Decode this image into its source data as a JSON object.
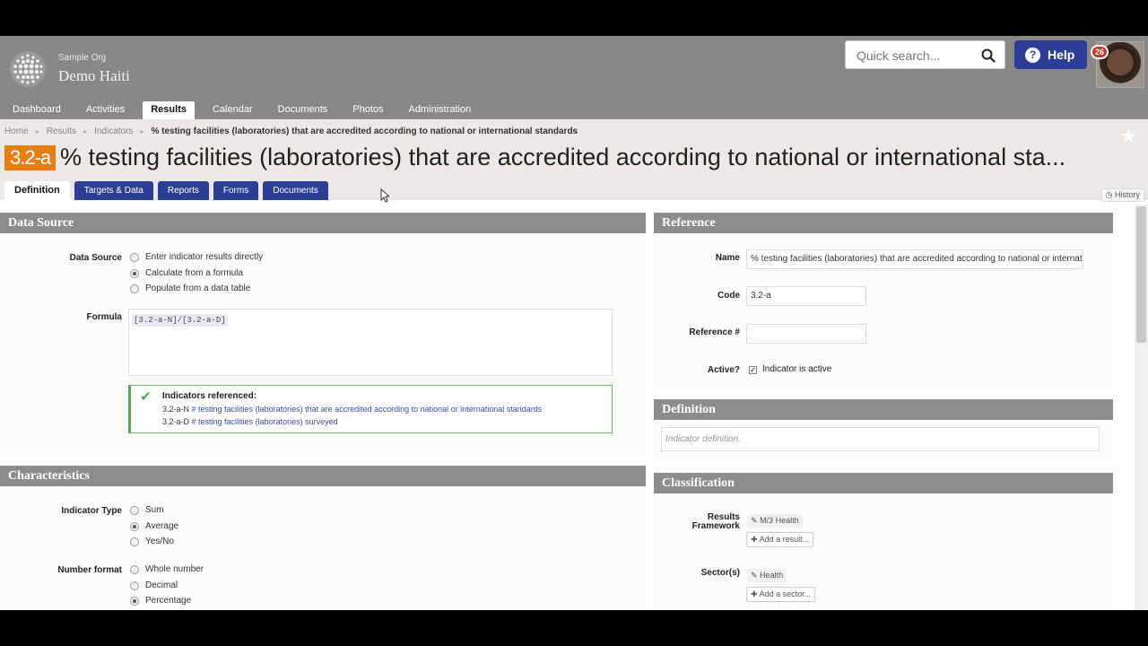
{
  "header": {
    "org_small": "Sample Org",
    "org_name": "Demo Haiti",
    "search_placeholder": "Quick search...",
    "help_label": "Help",
    "notification_count": "26"
  },
  "nav": {
    "items": [
      {
        "label": "Dashboard"
      },
      {
        "label": "Activities"
      },
      {
        "label": "Results"
      },
      {
        "label": "Calendar"
      },
      {
        "label": "Documents"
      },
      {
        "label": "Photos"
      },
      {
        "label": "Administration"
      }
    ],
    "active": "Results"
  },
  "breadcrumb": [
    "Home",
    "Results",
    "Indicators",
    "% testing facilities (laboratories) that are accredited according to national or international standards"
  ],
  "indicator": {
    "code": "3.2-a",
    "title": "% testing facilities (laboratories) that are accredited according to national or international sta..."
  },
  "tabs": [
    "Definition",
    "Targets & Data",
    "Reports",
    "Forms",
    "Documents"
  ],
  "history_label": "History",
  "data_source": {
    "heading": "Data Source",
    "label": "Data Source",
    "options": [
      "Enter indicator results directly",
      "Calculate from a formula",
      "Populate from a data table"
    ],
    "selected": "Calculate from a formula",
    "formula_label": "Formula",
    "formula": "[3.2-a-N]/[3.2-a-D]",
    "refs_title": "Indicators referenced:",
    "refs": [
      {
        "code": "3.2-a-N",
        "name": "# testing facilities (laboratories) that are accredited according to national or international standards"
      },
      {
        "code": "3.2-a-D",
        "name": "# testing facilities (laboratories) surveyed"
      }
    ]
  },
  "characteristics": {
    "heading": "Characteristics",
    "type_label": "Indicator Type",
    "type_options": [
      "Sum",
      "Average",
      "Yes/No"
    ],
    "type_selected": "Average",
    "format_label": "Number format",
    "format_options": [
      "Whole number",
      "Decimal",
      "Percentage"
    ],
    "format_selected": "Percentage"
  },
  "reference": {
    "heading": "Reference",
    "name_label": "Name",
    "name_value": "% testing facilities (laboratories) that are accredited according to national or international standards",
    "code_label": "Code",
    "code_value": "3.2-a",
    "refnum_label": "Reference #",
    "refnum_value": "",
    "active_label": "Active?",
    "active_text": "Indicator is active"
  },
  "definition": {
    "heading": "Definition",
    "placeholder": "Indicator definition."
  },
  "classification": {
    "heading": "Classification",
    "framework_label": "Results Framework",
    "framework_tag": "M/3 Health",
    "framework_add": "Add a result...",
    "sector_label": "Sector(s)",
    "sector_tag": "Health",
    "sector_add": "Add a sector..."
  }
}
